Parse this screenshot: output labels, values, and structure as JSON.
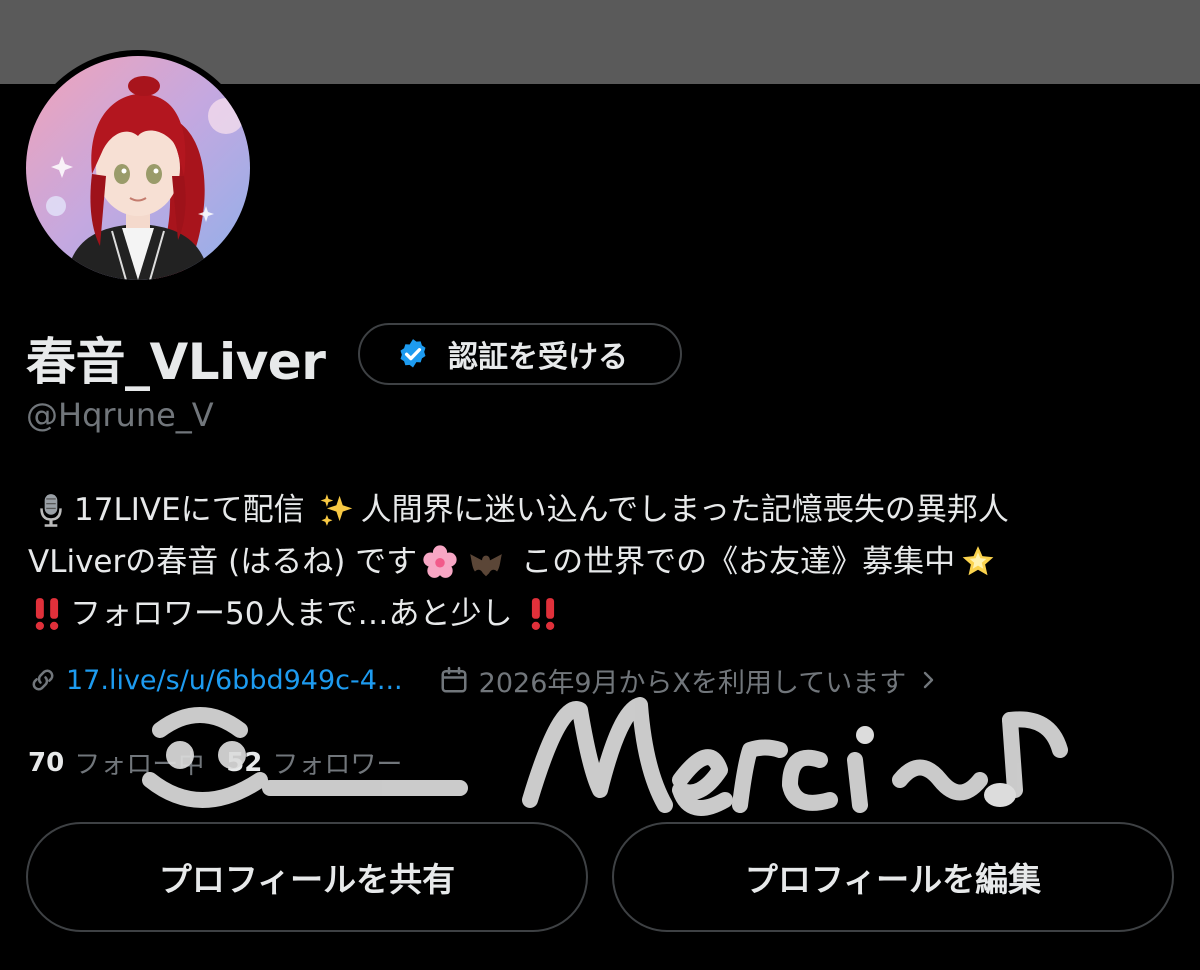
{
  "profile": {
    "display_name": "春音_VLiver",
    "handle": "@Hqrune_V",
    "verify_button_label": "認証を受ける"
  },
  "bio": {
    "line1_a": "17LIVEにて配信",
    "line1_b": "人間界に迷い込んでしまった記憶喪失の異邦人",
    "line2_a": "VLiverの春音 (はるね) です",
    "line2_b": "この世界での《お友達》募集中",
    "line3_a": "フォロワー50人まで…あと少し"
  },
  "meta": {
    "link_text": "17.live/s/u/6bbd949c-4...",
    "joined_text": "2026年9月からXを利用しています"
  },
  "stats": {
    "following_count": "70",
    "following_label": "フォロー中",
    "followers_count": "52",
    "followers_label": "フォロワー"
  },
  "buttons": {
    "share_profile": "プロフィールを共有",
    "edit_profile": "プロフィールを編集"
  },
  "overlay_text": "Merci~♪",
  "colors": {
    "background": "#000000",
    "banner": "#5a5a5a",
    "link": "#1d9bf0",
    "verified_badge": "#1d9bf0",
    "secondary_text": "#71767b"
  },
  "icons": [
    "verified-badge-icon",
    "microphone-icon",
    "sparkles-icon",
    "cherry-blossom-icon",
    "bat-icon",
    "glowing-star-icon",
    "double-exclamation-icon",
    "link-icon",
    "calendar-icon",
    "chevron-right-icon"
  ]
}
